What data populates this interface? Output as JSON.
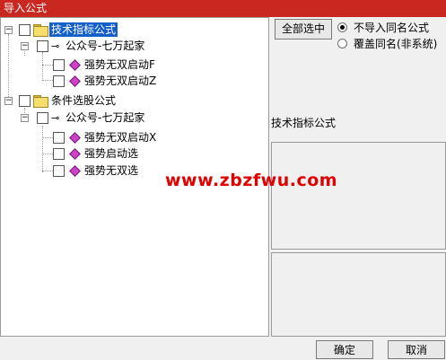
{
  "window": {
    "title": "导入公式"
  },
  "tree": {
    "groups": [
      {
        "label": "技术指标公式",
        "selected": true,
        "author": "公众号-七万起家",
        "items": [
          "强势无双启动F",
          "强势无双启动Z"
        ]
      },
      {
        "label": "条件选股公式",
        "selected": false,
        "author": "公众号-七万起家",
        "items": [
          "强势无双启动X",
          "强势启动选",
          "强势无双选"
        ]
      }
    ]
  },
  "controls": {
    "select_all_label": "全部选中",
    "radio_options": [
      {
        "label": "不导入同名公式",
        "checked": true
      },
      {
        "label": "覆盖同名(非系统)",
        "checked": false
      }
    ]
  },
  "details": {
    "type_label": "技术指标公式"
  },
  "watermark": "www.zbzfwu.com",
  "footer": {
    "ok_label": "确定",
    "cancel_label": "取消"
  }
}
